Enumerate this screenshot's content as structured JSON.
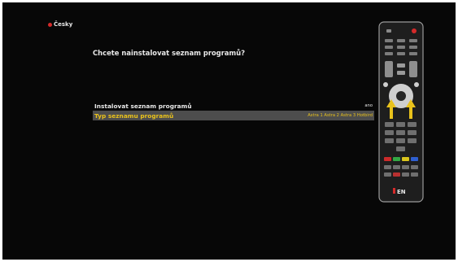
{
  "header": {
    "language_label": "Česky"
  },
  "dialog": {
    "question": "Chcete nainstalovat seznam programů?",
    "items": [
      {
        "label": "Instalovat seznam programů",
        "value": "ano",
        "selected": false
      },
      {
        "label": "Typ seznamu programů",
        "value": "Astra 1 Astra 2 Astra 3 Hotbird",
        "selected": true
      }
    ]
  },
  "remote": {
    "brand_label": "EN",
    "highlight_color": "#e9c21b"
  }
}
